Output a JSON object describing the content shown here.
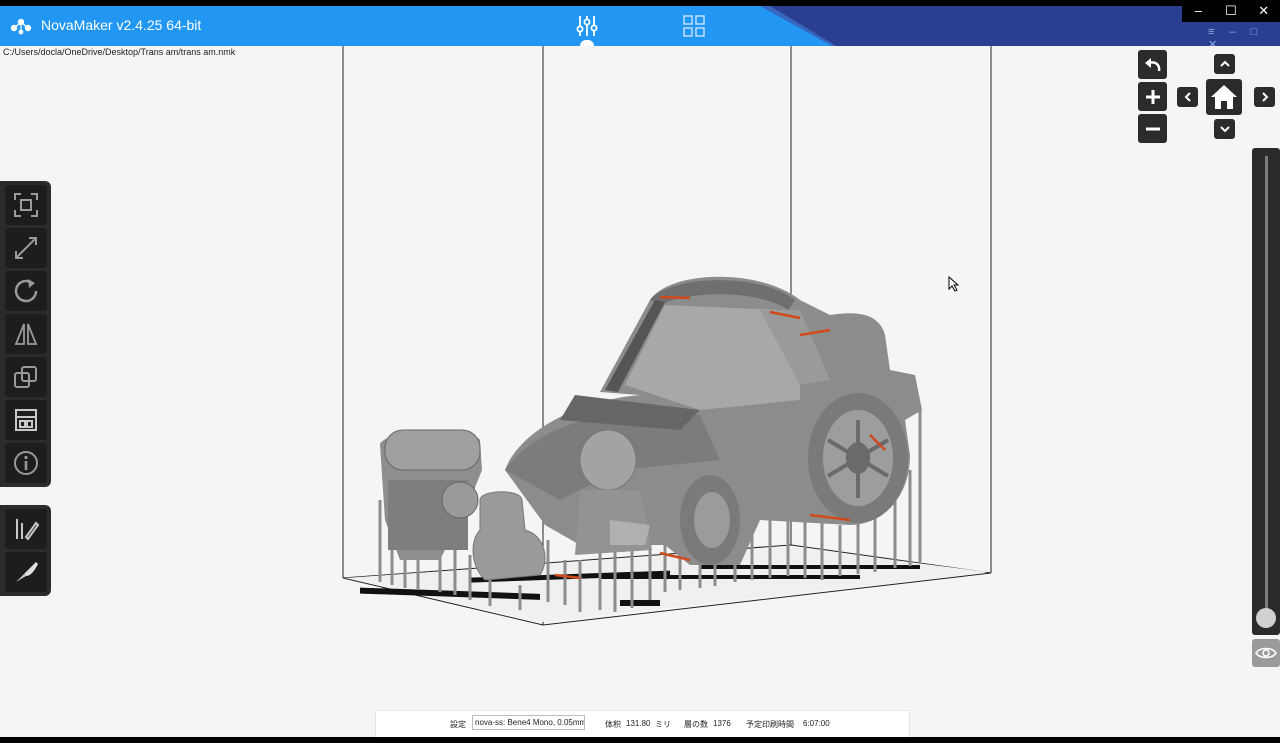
{
  "window": {
    "title": "NovaMaker v2.4.25 64-bit",
    "minimize": "–",
    "maximize": "☐",
    "close": "✕"
  },
  "tabs": [
    {
      "icon": "sliders-icon",
      "selected": true
    },
    {
      "icon": "grid-icon",
      "selected": false
    }
  ],
  "file_path": "C:/Users/docla/OneDrive/Desktop/Trans am/trans am.nmk",
  "left_toolbar": {
    "group1": [
      "auto-layout-icon",
      "scale-icon",
      "rotate-icon",
      "mirror-icon",
      "duplicate-icon",
      "layout-icon",
      "info-icon"
    ],
    "group2": [
      "support-edit-icon",
      "knife-icon"
    ]
  },
  "view_controls": [
    "undo-icon",
    "zoom-in-icon",
    "zoom-out-icon",
    "view-up-icon",
    "view-left-icon",
    "home-view-icon",
    "view-right-icon",
    "view-down-icon"
  ],
  "layer_slider": {
    "position": 1.0
  },
  "status": {
    "settings_label": "設定",
    "settings_value": "nova-ss: Bene4 Mono, 0.05mm",
    "volume_label": "体积",
    "volume_value": "131.80",
    "volume_unit": "ミリ",
    "layers_label": "層の数",
    "layers_value": "1376",
    "time_label": "予定印刷時間",
    "time_value": "6:07:00"
  },
  "colors": {
    "titlebar": "#2196f3",
    "titlebar_dark": "#2a3f91",
    "panel": "#2b2b2b",
    "model": "#8a8a8a",
    "overhang": "#d04a1c"
  }
}
